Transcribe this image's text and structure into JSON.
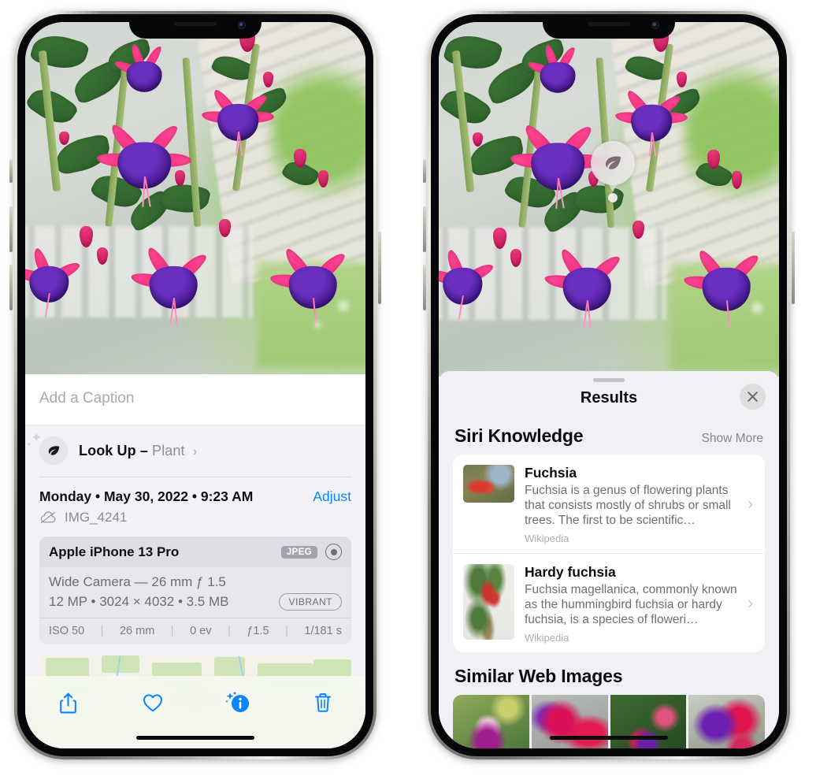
{
  "left_phone": {
    "caption_placeholder": "Add a Caption",
    "lookup": {
      "label": "Look Up",
      "dash": "–",
      "subject": "Plant",
      "chevron": "›",
      "icon": "leaf-icon"
    },
    "date_line": "Monday • May 30, 2022 • 9:23 AM",
    "adjust_label": "Adjust",
    "filename": "IMG_4241",
    "cloud_icon": "cloud-slash-icon",
    "exif": {
      "device": "Apple iPhone 13 Pro",
      "format_badge": "JPEG",
      "hdr_icon": "hdr-aperture-icon",
      "lens": "Wide Camera — 26 mm ƒ 1.5",
      "size_line": "12 MP • 3024 × 4032 • 3.5 MB",
      "style_badge": "VIBRANT",
      "settings": [
        "ISO 50",
        "26 mm",
        "0 ev",
        "ƒ1.5",
        "1/181 s"
      ]
    },
    "toolbar": [
      {
        "name": "share-button",
        "icon": "share-icon"
      },
      {
        "name": "favorite-button",
        "icon": "heart-icon"
      },
      {
        "name": "info-button",
        "icon": "info-sparkle-icon"
      },
      {
        "name": "delete-button",
        "icon": "trash-icon"
      }
    ],
    "accent_color": "#0a84ff"
  },
  "right_phone": {
    "visual_lookup_badge_icon": "leaf-icon",
    "sheet": {
      "title": "Results",
      "close_icon": "close-icon",
      "sections": [
        {
          "title": "Siri Knowledge",
          "action": "Show More",
          "items": [
            {
              "title": "Fuchsia",
              "description": "Fuchsia is a genus of flowering plants that consists mostly of shrubs or small trees. The first to be scientific…",
              "source": "Wikipedia"
            },
            {
              "title": "Hardy fuchsia",
              "description": "Fuchsia magellanica, commonly known as the hummingbird fuchsia or hardy fuchsia, is a species of floweri…",
              "source": "Wikipedia"
            }
          ]
        },
        {
          "title": "Similar Web Images",
          "images": [
            "web-image-1",
            "web-image-2",
            "web-image-3",
            "web-image-4"
          ]
        }
      ]
    }
  }
}
